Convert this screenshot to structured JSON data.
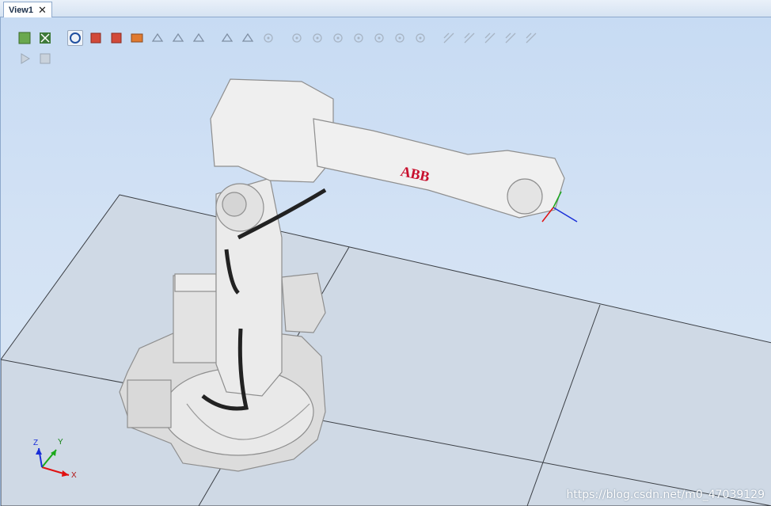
{
  "tab": {
    "title": "View1",
    "close_symbol": "✕"
  },
  "toolbar": {
    "row1": [
      "view-all-icon",
      "view-center-icon",
      "select-curve-icon",
      "select-surface-icon",
      "select-body-icon",
      "select-part-icon",
      "select-mechanism-icon",
      "select-group-icon",
      "select-target-icon",
      "select-frame-icon",
      "select-path-icon",
      "snap-object-icon",
      "snap-center-icon",
      "snap-mid-icon",
      "snap-edge-icon",
      "snap-end-icon",
      "snap-local-origin-icon",
      "snap-grid-icon",
      "snap-all-icon",
      "measure-distance-icon",
      "measure-angle-icon",
      "measure-diameter-icon",
      "measure-minimum-distance-icon",
      "measure-keep-icon"
    ],
    "row2": [
      "play-simulation-icon",
      "stop-simulation-icon"
    ]
  },
  "robot": {
    "brand": "ABB"
  },
  "axes": {
    "x": "X",
    "y": "Y",
    "z": "Z"
  },
  "colors": {
    "floor": "#c9d3e0",
    "robot": "#e6e6e6",
    "brand_red": "#c8102e",
    "axis_x": "#e01010",
    "axis_y": "#1aa81a",
    "axis_z": "#1a2fd8"
  },
  "watermark": "https://blog.csdn.net/m0_47039129"
}
